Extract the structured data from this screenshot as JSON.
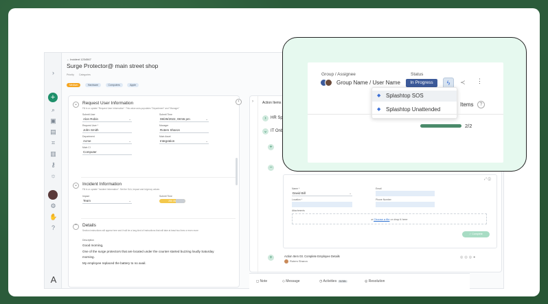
{
  "header": {
    "breadcrumb": "← Incident 1234567",
    "title": "Surge Protector@ main street shop",
    "priority_label": "Priority",
    "priority_value": "Medium",
    "categories_label": "Categories",
    "categories": [
      "Hardware",
      "Computers",
      "Apple"
    ]
  },
  "request_info": {
    "title": "Request User Information",
    "subtitle": "Fill in or update \"Request User Information\". This value auto-populates \"Department\" and \"Manager\"",
    "submit_user_label": "Submit User",
    "submit_user": "Alon Robin",
    "submit_time_label": "Submit Time",
    "submit_time": "08/29/2022, 08:55 pm",
    "request_user_label": "Request User *",
    "request_user": "John Smith",
    "manager_label": "Manager",
    "manager": "Rotem Sharon",
    "department_label": "Department",
    "department": "Acme",
    "main_asset_label": "Main Asset",
    "main_asset": "Integration",
    "main_ci_label": "Main CI",
    "main_ci": "Computer"
  },
  "incident_info": {
    "title": "Incident Information",
    "subtitle": "Fill in or update \"Incident Information\". Set the SLA, Impact and Urgency values",
    "impact_label": "Impact",
    "impact": "Team",
    "submit_time_label": "Submit Time",
    "sla_badge": "25h 4hr"
  },
  "details": {
    "title": "Details",
    "subtitle": "Section instructions will appear here and it will be a long kind of instructions that will take at least two lines or even more",
    "description_label": "Description",
    "description_lines": [
      "Good morning,",
      "One of the surge protectors that are located under the counter started buzzing loudly Saturday",
      "morning.",
      "My employee replaced the battery to no avail."
    ]
  },
  "action_panel": {
    "tab": "Action Items",
    "hr_label": "HR Sp",
    "it_label": "IT Onbo",
    "name_label": "Name *",
    "name_value": "David Bill",
    "email_label": "Email",
    "location_label": "Location *",
    "phone_label": "Phone Number",
    "attachments_label": "Attachments",
    "drop_text_link": "Choose a file",
    "drop_text_rest": " or drop it here",
    "complete_button": "✓ Complete",
    "item3_title": "Action Item 03. Complete Employee Details",
    "item3_user": "Rotem Sharon"
  },
  "bottom_bar": {
    "note": "Note",
    "message": "Message",
    "activities": "Activities",
    "activities_count": "30/38h",
    "resolution": "Resolution"
  },
  "popup": {
    "group_label": "Group / Assignee",
    "group_value": "Group Name / User Name",
    "status_label": "Status",
    "status_value": "In Progress",
    "items_tab": "Items",
    "progress_text": "2/2",
    "progress_fraction": 1.0,
    "menu_items": [
      "Splashtop SOS",
      "Splashtop Unattended"
    ]
  },
  "rail": {
    "logo": "A"
  },
  "colors": {
    "accent": "#1e8f6a",
    "status_blue": "#3c5a9a",
    "medium_chip": "#f5a623",
    "popup_bg": "#e6f9ef"
  }
}
